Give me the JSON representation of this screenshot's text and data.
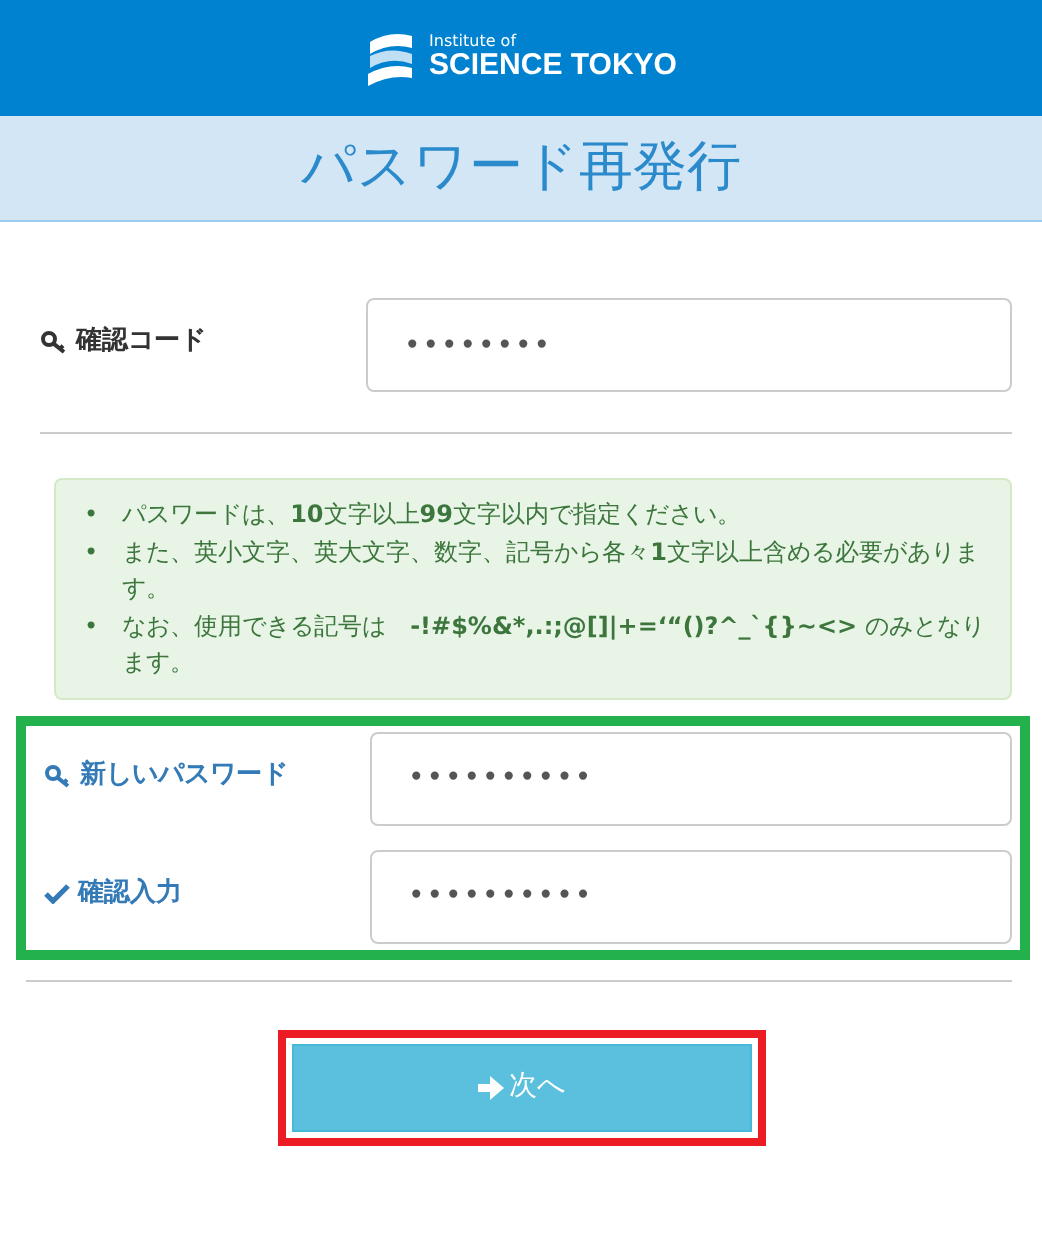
{
  "header": {
    "logo_small": "Institute of",
    "logo_large": "SCIENCE TOKYO"
  },
  "title": "パスワード再発行",
  "code_field": {
    "label": "確認コード",
    "kind": "key",
    "value": "••••••••"
  },
  "notes": [
    {
      "bullet": "•",
      "text": "パスワードは、**10**文字以上**99**文字以内で指定ください。"
    },
    {
      "bullet": "•",
      "text": "また、英小文字、英大文字、数字、記号から各々**1**文字以上含める必要があります。"
    },
    {
      "bullet": "•",
      "text": "なお、使用できる記号は　**-!#$%&*,.:;@[]|+=‘“()?^_`{}~<>** のみとなります。"
    }
  ],
  "password_fields": [
    {
      "label": "新しいパスワード",
      "kind": "key",
      "value": "••••••••••"
    },
    {
      "label": "確認入力",
      "kind": "check",
      "value": "••••••••••"
    }
  ],
  "submit": {
    "label": "次へ"
  }
}
